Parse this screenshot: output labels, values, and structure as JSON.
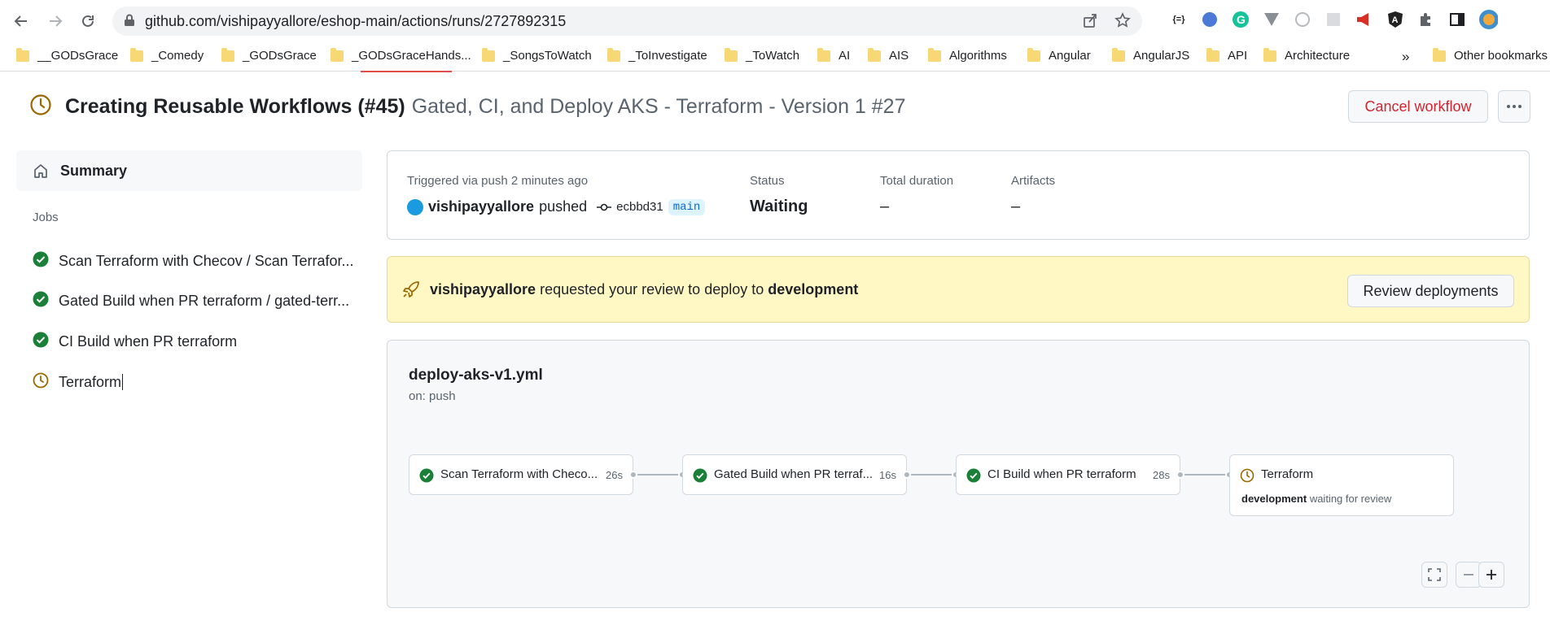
{
  "browser": {
    "url": "github.com/vishipayyallore/eshop-main/actions/runs/2727892315",
    "bookmarks": [
      "__GODsGrace",
      "_Comedy",
      "_GODsGrace",
      "_GODsGraceHands...",
      "_SongsToWatch",
      "_ToInvestigate",
      "_ToWatch",
      "AI",
      "AIS",
      "Algorithms",
      "Angular",
      "AngularJS",
      "API",
      "Architecture"
    ],
    "overflow": "»",
    "other_bookmarks": "Other bookmarks",
    "ext_json": "{=}"
  },
  "header": {
    "title": "Creating Reusable Workflows (#45)",
    "subtitle": "Gated, CI, and Deploy AKS - Terraform - Version 1 #27",
    "cancel_label": "Cancel workflow"
  },
  "sidebar": {
    "summary_label": "Summary",
    "jobs_heading": "Jobs",
    "jobs": [
      {
        "label": "Scan Terraform with Checov / Scan Terrafor...",
        "status": "success"
      },
      {
        "label": "Gated Build when PR terraform / gated-terr...",
        "status": "success"
      },
      {
        "label": "CI Build when PR terraform",
        "status": "success"
      },
      {
        "label": "Terraform",
        "status": "waiting"
      }
    ]
  },
  "run_info": {
    "trigger_label": "Triggered via push 2 minutes ago",
    "actor": "vishipayyallore",
    "verb": "pushed",
    "commit": "ecbbd31",
    "branch": "main",
    "status_label": "Status",
    "status_value": "Waiting",
    "duration_label": "Total duration",
    "duration_value": "–",
    "artifacts_label": "Artifacts",
    "artifacts_value": "–"
  },
  "review": {
    "actor": "vishipayyallore",
    "text": "requested your review to deploy to",
    "environment": "development",
    "button_label": "Review deployments"
  },
  "graph": {
    "workflow_file": "deploy-aks-v1.yml",
    "trigger": "on: push",
    "nodes": [
      {
        "label": "Scan Terraform with Checo...",
        "duration": "26s",
        "status": "success"
      },
      {
        "label": "Gated Build when PR terraf...",
        "duration": "16s",
        "status": "success"
      },
      {
        "label": "CI Build when PR terraform",
        "duration": "28s",
        "status": "success"
      },
      {
        "label": "Terraform",
        "duration": "",
        "status": "waiting",
        "env": "development",
        "env_note": "waiting for review"
      }
    ]
  },
  "colors": {
    "success": "#1a7f37",
    "waiting": "#9a6700",
    "danger": "#d1242f",
    "banner": "#fff8c5"
  }
}
